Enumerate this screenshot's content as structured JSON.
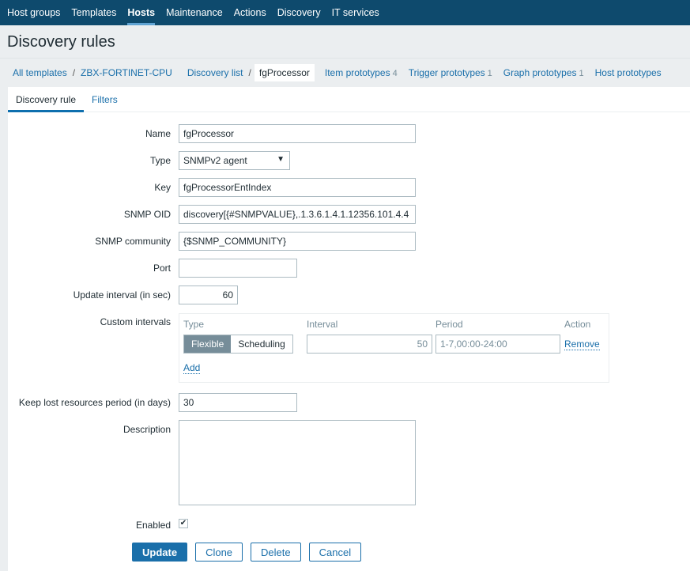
{
  "nav": [
    "Host groups",
    "Templates",
    "Hosts",
    "Maintenance",
    "Actions",
    "Discovery",
    "IT services"
  ],
  "title": "Discovery rules",
  "breadcrumb": {
    "all": "All templates",
    "template": "ZBX-FORTINET-CPU",
    "list": "Discovery list",
    "current": "fgProcessor",
    "items": "Item prototypes",
    "items_count": "4",
    "triggers": "Trigger prototypes",
    "triggers_count": "1",
    "graphs": "Graph prototypes",
    "graphs_count": "1",
    "hosts": "Host prototypes"
  },
  "tabs": [
    "Discovery rule",
    "Filters"
  ],
  "form": {
    "name_label": "Name",
    "name": "fgProcessor",
    "type_label": "Type",
    "type": "SNMPv2 agent",
    "key_label": "Key",
    "key": "fgProcessorEntIndex",
    "oid_label": "SNMP OID",
    "oid": "discovery[{#SNMPVALUE},.1.3.6.1.4.1.12356.101.4.4",
    "community_label": "SNMP community",
    "community": "{$SNMP_COMMUNITY}",
    "port_label": "Port",
    "port": "",
    "interval_label": "Update interval (in sec)",
    "interval": "60",
    "custom_label": "Custom intervals",
    "custom": {
      "h_type": "Type",
      "h_interval": "Interval",
      "h_period": "Period",
      "h_action": "Action",
      "flexible": "Flexible",
      "scheduling": "Scheduling",
      "interval": "50",
      "period": "1-7,00:00-24:00",
      "remove": "Remove",
      "add": "Add"
    },
    "lifetime_label": "Keep lost resources period (in days)",
    "lifetime": "30",
    "description_label": "Description",
    "description": "",
    "enabled_label": "Enabled",
    "enabled": true
  },
  "buttons": {
    "update": "Update",
    "clone": "Clone",
    "delete": "Delete",
    "cancel": "Cancel"
  }
}
